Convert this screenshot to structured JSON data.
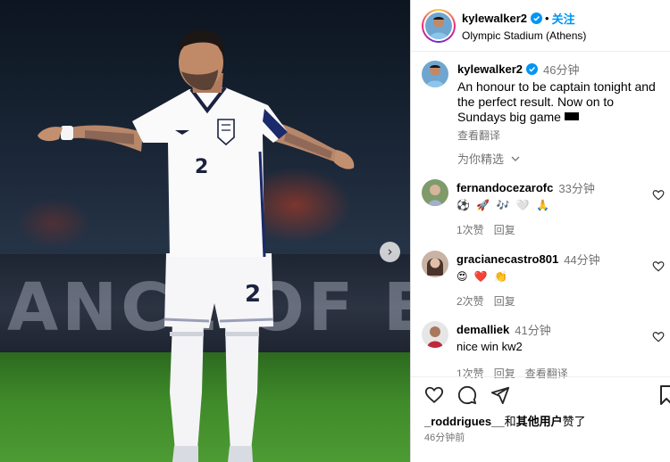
{
  "post": {
    "username": "kylewalker2",
    "follow_label": "关注",
    "location": "Olympic Stadium (Athens)",
    "separator": "•"
  },
  "photo": {
    "next_icon": "›",
    "shirt_number": "2"
  },
  "caption": {
    "username": "kylewalker2",
    "time": "46分钟",
    "text": "An honour to be captain tonight and the perfect result. Now on to Sundays big game",
    "translate_label": "查看翻译"
  },
  "curated_label": "为你精选",
  "comments": [
    {
      "username": "fernandocezarofc",
      "time": "33分钟",
      "emoji": "⚽ 🚀 🎶 🤍 🙏",
      "text": "",
      "likes": "1次赞",
      "reply": "回复",
      "translate": ""
    },
    {
      "username": "gracianecastro801",
      "time": "44分钟",
      "emoji": "😍 ❤️ 👏",
      "text": "",
      "likes": "2次赞",
      "reply": "回复",
      "translate": ""
    },
    {
      "username": "demalliek",
      "time": "41分钟",
      "emoji": "",
      "text": "nice win kw2",
      "likes": "1次赞",
      "reply": "回复",
      "translate": "查看翻译"
    }
  ],
  "likes_line": {
    "user": "_roddrigues__",
    "joiner": "和",
    "others": "其他用户",
    "suffix": "赞了"
  },
  "posted_ago": "46分钟前",
  "colors": {
    "accent": "#0095f6",
    "secondary_text": "#737373",
    "verified": "#0095f6"
  }
}
